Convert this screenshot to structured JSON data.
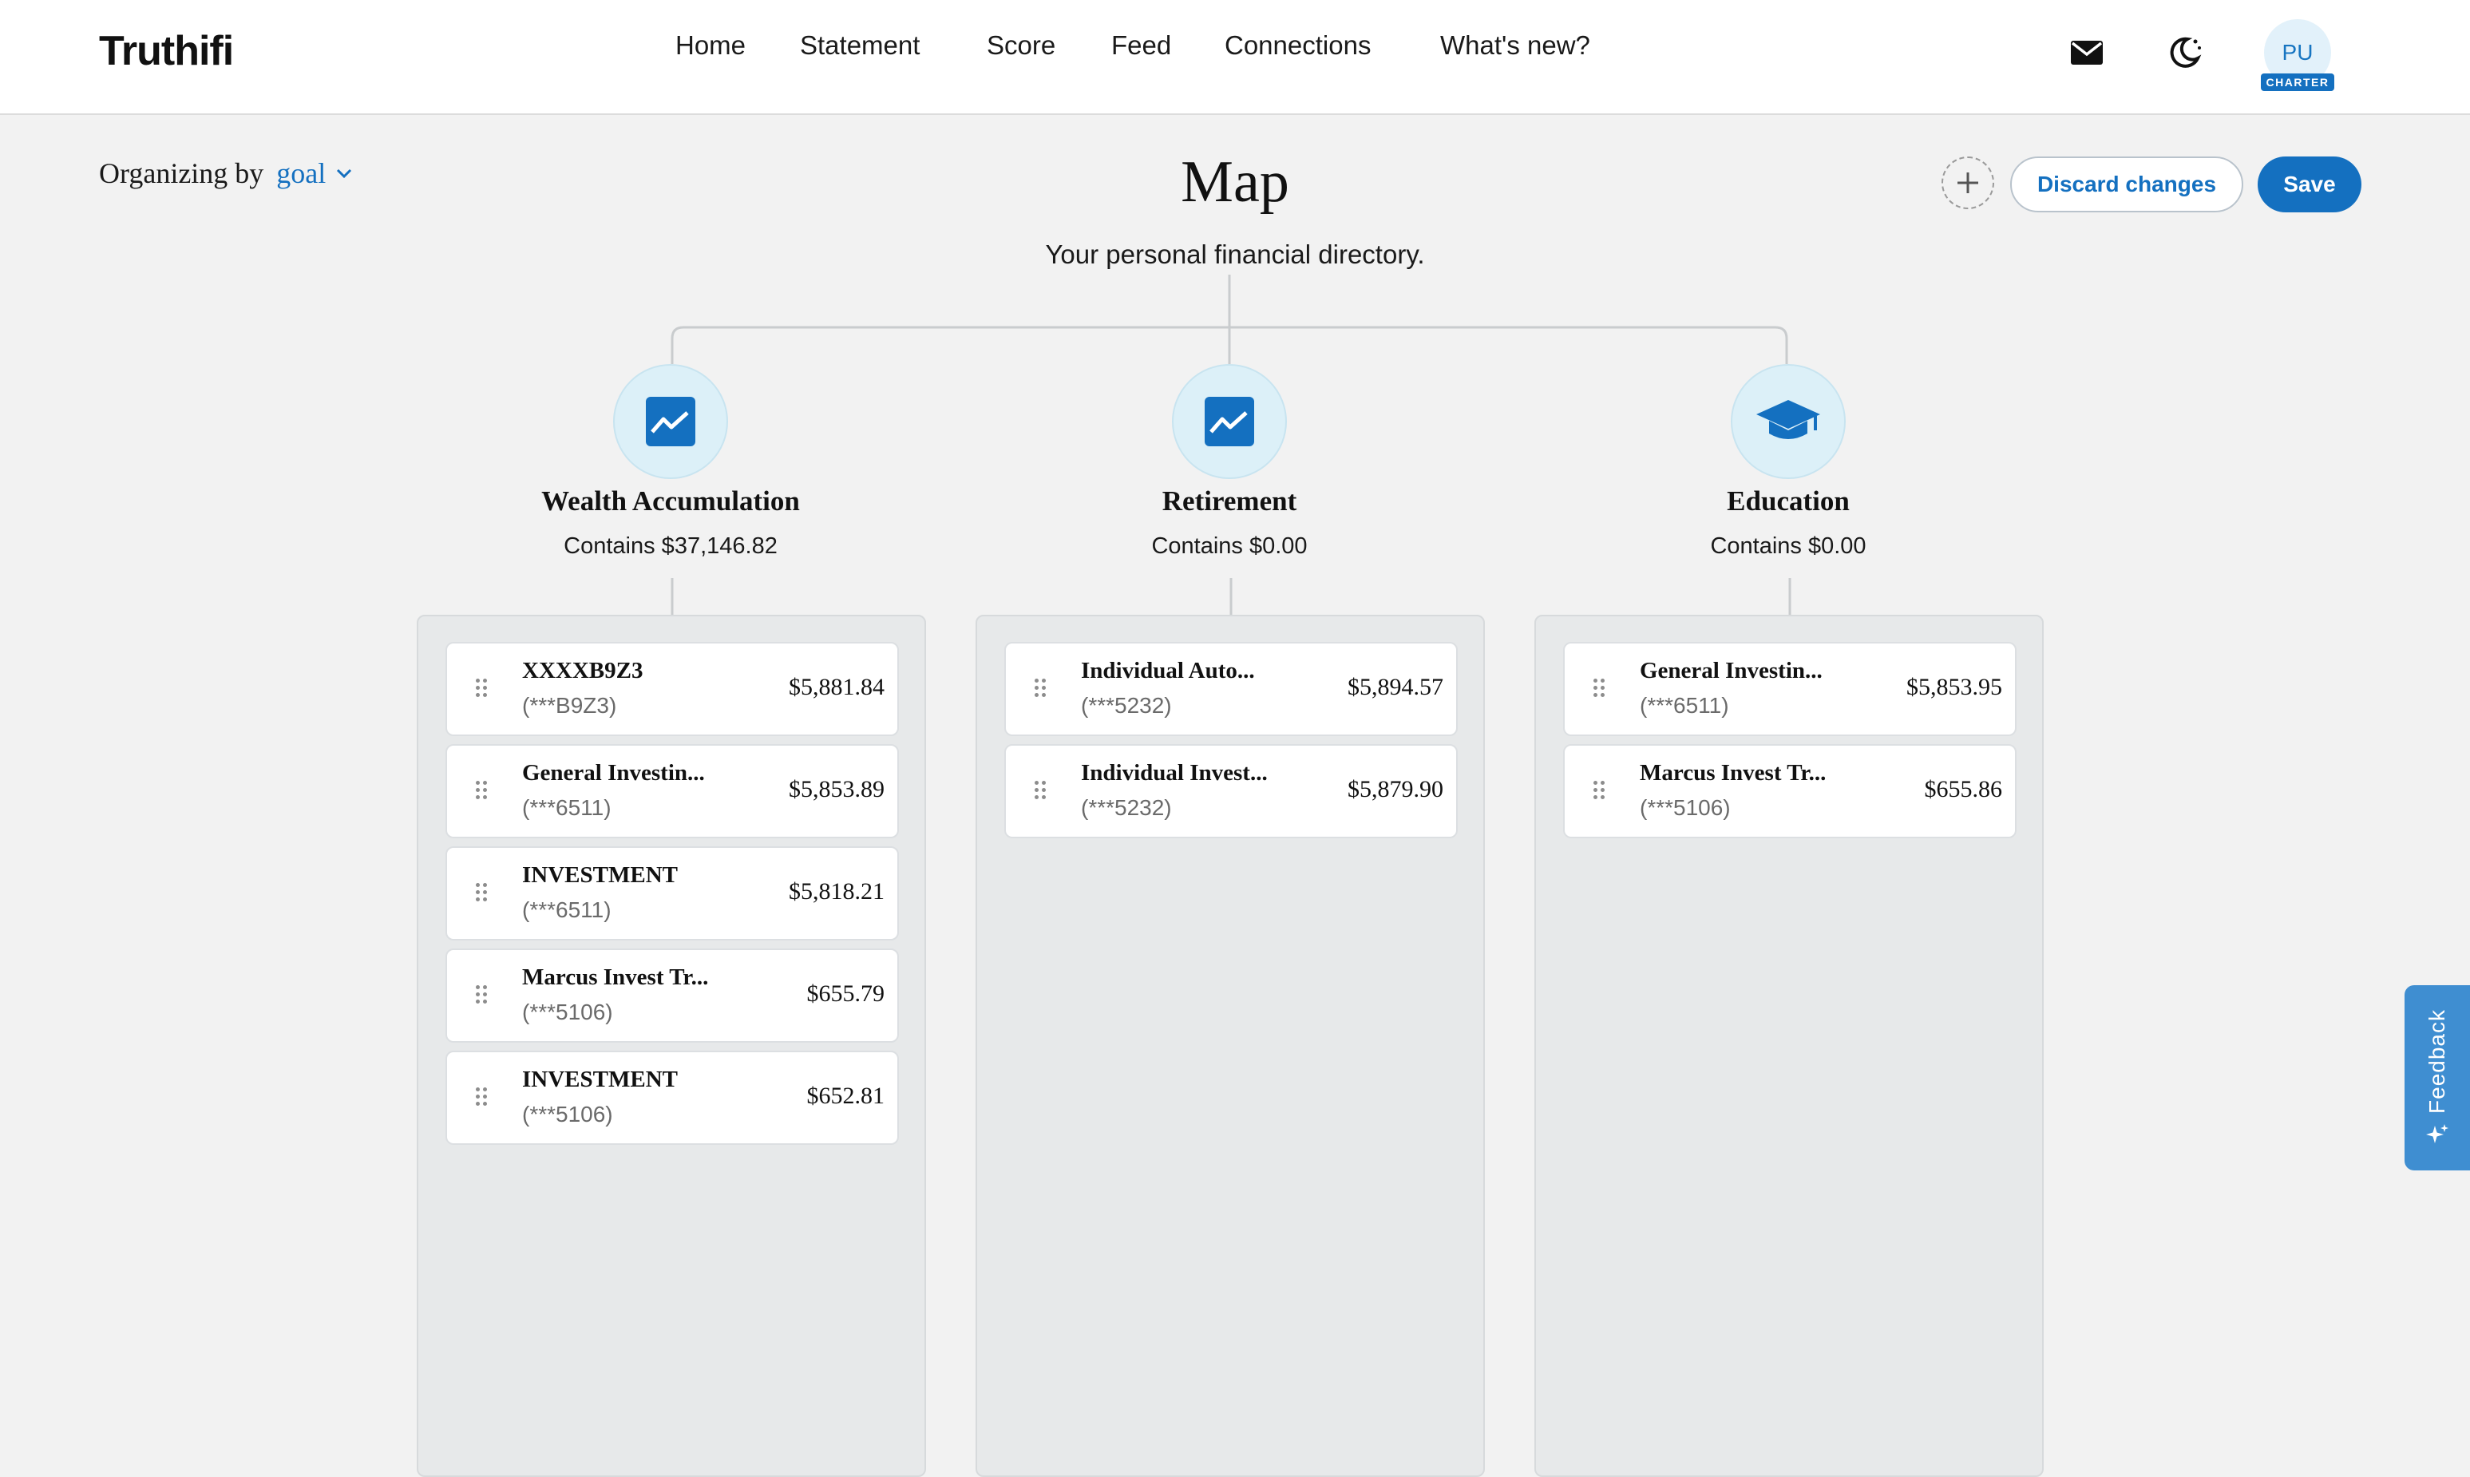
{
  "header": {
    "logo": "Truthifi",
    "nav": [
      "Home",
      "Statement",
      "Score",
      "Feed",
      "Connections",
      "What's new?"
    ],
    "avatar_initials": "PU",
    "avatar_badge": "CHARTER",
    "icons": [
      "mail-icon",
      "dark-mode-icon"
    ]
  },
  "toolbar": {
    "organizing_label": "Organizing by",
    "organizing_value": "goal",
    "discard_label": "Discard changes",
    "save_label": "Save"
  },
  "page": {
    "title": "Map",
    "subtitle": "Your personal financial directory."
  },
  "goals": [
    {
      "name": "Wealth Accumulation",
      "contains": "Contains $37,146.82",
      "icon": "chart-line-icon",
      "accounts": [
        {
          "name": "XXXXB9Z3",
          "number": "(***B9Z3)",
          "amount": "$5,881.84"
        },
        {
          "name": "General Investin...",
          "number": "(***6511)",
          "amount": "$5,853.89"
        },
        {
          "name": "INVESTMENT",
          "number": "(***6511)",
          "amount": "$5,818.21"
        },
        {
          "name": "Marcus Invest Tr...",
          "number": "(***5106)",
          "amount": "$655.79"
        },
        {
          "name": "INVESTMENT",
          "number": "(***5106)",
          "amount": "$652.81"
        }
      ]
    },
    {
      "name": "Retirement",
      "contains": "Contains $0.00",
      "icon": "chart-line-icon",
      "accounts": [
        {
          "name": "Individual Auto...",
          "number": "(***5232)",
          "amount": "$5,894.57"
        },
        {
          "name": "Individual Invest...",
          "number": "(***5232)",
          "amount": "$5,879.90"
        }
      ]
    },
    {
      "name": "Education",
      "contains": "Contains $0.00",
      "icon": "graduation-cap-icon",
      "accounts": [
        {
          "name": "General Investin...",
          "number": "(***6511)",
          "amount": "$5,853.95"
        },
        {
          "name": "Marcus Invest Tr...",
          "number": "(***5106)",
          "amount": "$655.86"
        }
      ]
    }
  ],
  "feedback": {
    "label": "Feedback"
  },
  "colors": {
    "accent": "#1470c0",
    "background": "#f2f2f2",
    "column": "#e7e9ea",
    "icon_circle": "#dcf0f8",
    "feedback": "#3f8ed1"
  }
}
